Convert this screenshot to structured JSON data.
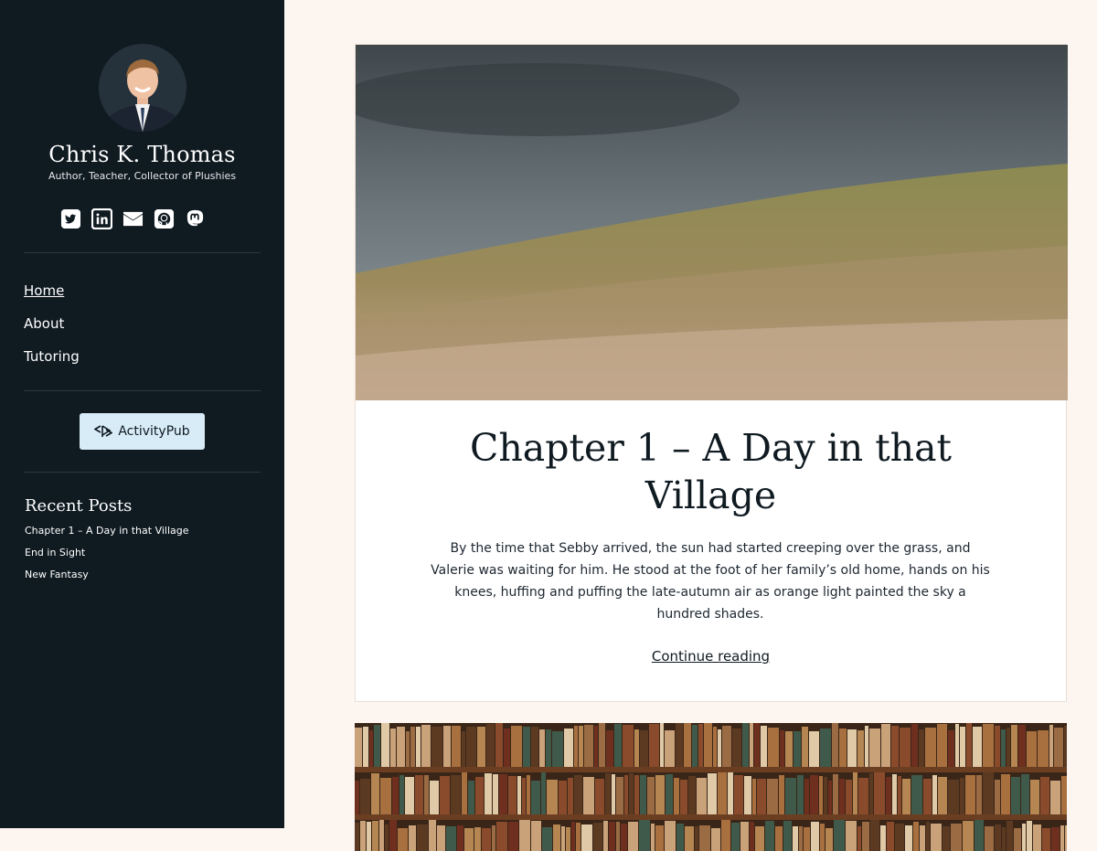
{
  "site": {
    "title": "Chris K. Thomas",
    "tagline": "Author, Teacher, Collector of Plushies"
  },
  "social_icons": [
    "twitter-icon",
    "linkedin-icon",
    "email-icon",
    "github-icon",
    "mastodon-icon"
  ],
  "nav": {
    "items": [
      {
        "label": "Home",
        "current": true
      },
      {
        "label": "About"
      },
      {
        "label": "Tutoring"
      }
    ]
  },
  "activitypub": {
    "label": "ActivityPub"
  },
  "recent_posts": {
    "heading": "Recent Posts",
    "items": [
      {
        "label": "Chapter 1 – A Day in that Village"
      },
      {
        "label": "End in Sight"
      },
      {
        "label": "New Fantasy"
      }
    ]
  },
  "post": {
    "title": "Chapter 1 – A Day in that Village",
    "excerpt": "By the time that Sebby arrived, the sun had started creeping over the grass, and Valerie was waiting for him. He stood at the foot of her family’s old home, hands on his knees, huffing and puffing the late-autumn air as orange light painted the sky a hundred shades.",
    "continue_label": "Continue reading"
  },
  "colors": {
    "sidebar_bg": "#0f1a21",
    "page_bg": "#fdf5ef",
    "button_bg": "#d8ecf7"
  }
}
